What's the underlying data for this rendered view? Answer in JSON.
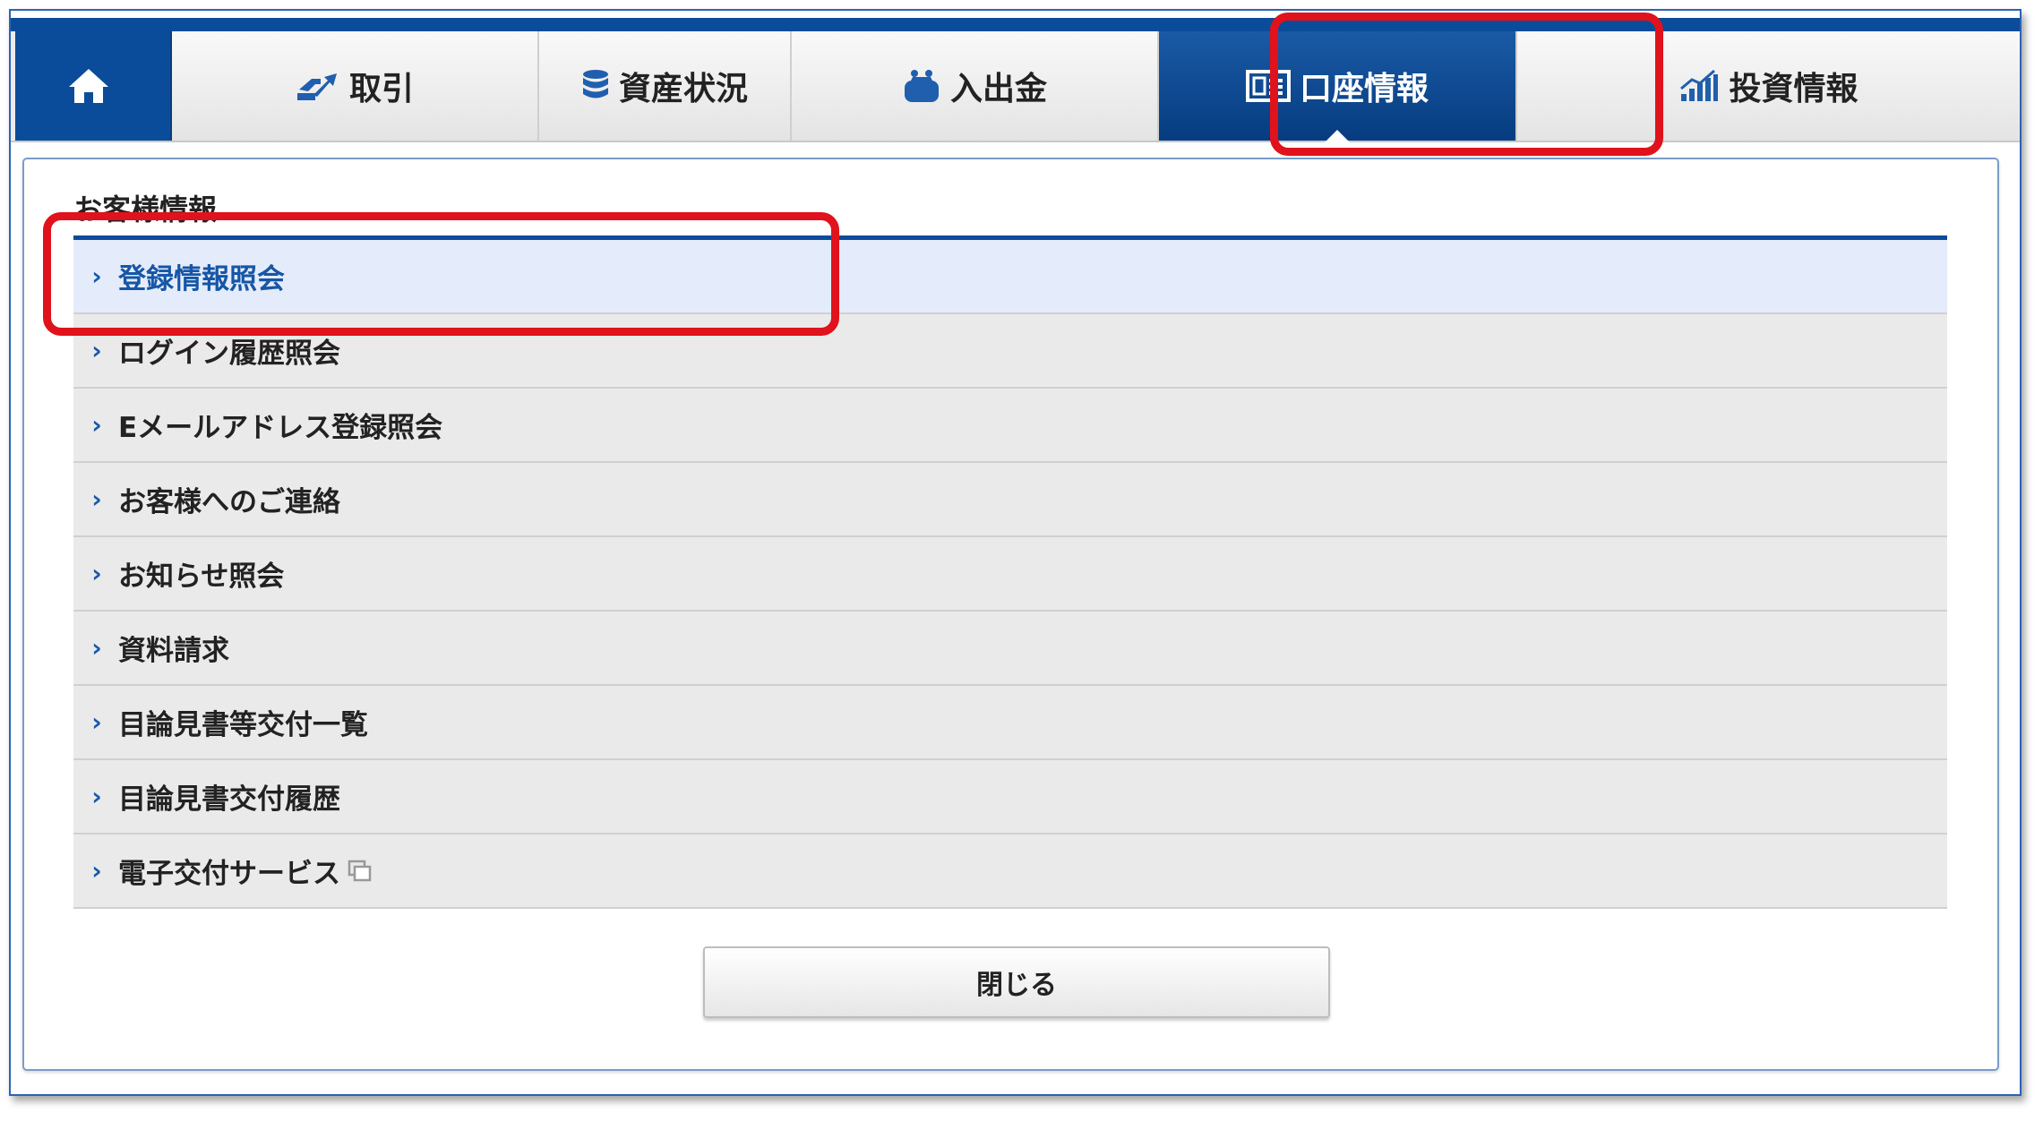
{
  "nav": {
    "home_label": "",
    "tabs": [
      {
        "label": "取引",
        "icon": "trade-icon"
      },
      {
        "label": "資産状況",
        "icon": "database-icon"
      },
      {
        "label": "入出金",
        "icon": "wallet-icon"
      },
      {
        "label": "口座情報",
        "icon": "id-card-icon"
      },
      {
        "label": "投資情報",
        "icon": "chart-icon"
      }
    ]
  },
  "section": {
    "title": "お客様情報",
    "items": [
      {
        "label": "登録情報照会"
      },
      {
        "label": "ログイン履歴照会"
      },
      {
        "label": "Eメールアドレス登録照会"
      },
      {
        "label": "お客様へのご連絡"
      },
      {
        "label": "お知らせ照会"
      },
      {
        "label": "資料請求"
      },
      {
        "label": "目論見書等交付一覧"
      },
      {
        "label": "目論見書交付履歴"
      },
      {
        "label": "電子交付サービス"
      }
    ]
  },
  "close_button": {
    "label": "閉じる"
  },
  "colors": {
    "nav_primary": "#0a4c9a",
    "highlight": "#e0121b",
    "selected_row_bg": "#e4ecfb",
    "link_text": "#1656a6"
  }
}
